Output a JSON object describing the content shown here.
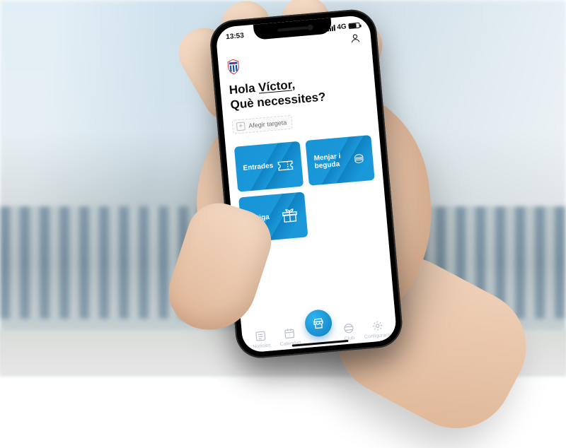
{
  "status": {
    "time": "13:53",
    "network": "4G"
  },
  "header": {
    "greeting_prefix": "Hola ",
    "user_name": "Víctor",
    "greeting_suffix": ",",
    "subtitle": "Què necessites?"
  },
  "add_card": {
    "label": "Afegir targeta",
    "plus": "+"
  },
  "tiles": [
    {
      "label": "Entrades",
      "icon": "ticket-icon"
    },
    {
      "label": "Menjar i beguda",
      "icon": "burger-icon"
    },
    {
      "label": "Botiga",
      "icon": "gift-icon"
    }
  ],
  "nav": {
    "items": [
      {
        "label": "Notícies",
        "icon": "news-icon"
      },
      {
        "label": "Calendari",
        "icon": "calendar-icon"
      },
      {
        "label": "",
        "icon": "store-icon"
      },
      {
        "label": "Club",
        "icon": "club-icon"
      },
      {
        "label": "Configuració",
        "icon": "gear-icon"
      }
    ]
  },
  "colors": {
    "accent": "#1a98da",
    "text": "#0d0d0d",
    "muted": "#b7becb"
  }
}
